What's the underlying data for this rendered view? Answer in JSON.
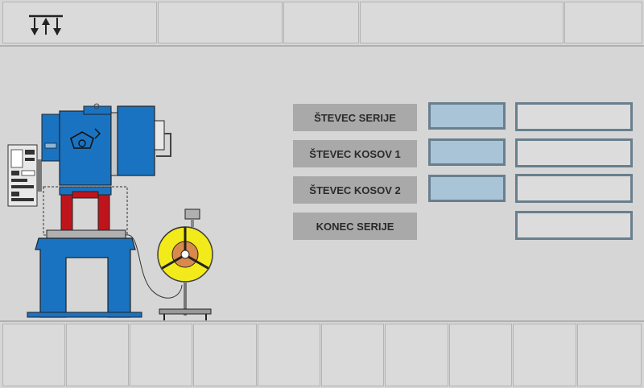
{
  "counters": [
    {
      "label": "ŠTEVEC SERIJE"
    },
    {
      "label": "ŠTEVEC KOSOV 1"
    },
    {
      "label": "ŠTEVEC KOSOV 2"
    },
    {
      "label": "KONEC SERIJE"
    }
  ],
  "icons": {
    "logo": "up-down-arrows-logo-icon",
    "machine": "press-machine-illustration-icon",
    "reel": "coil-reel-icon"
  },
  "colors": {
    "machine_blue": "#1a73c1",
    "press_red": "#c0141c",
    "reel_yellow": "#f2ea1a",
    "field_blue": "#a8c4d6",
    "field_border": "#687f8d",
    "label_bg": "#a9a9a9"
  }
}
